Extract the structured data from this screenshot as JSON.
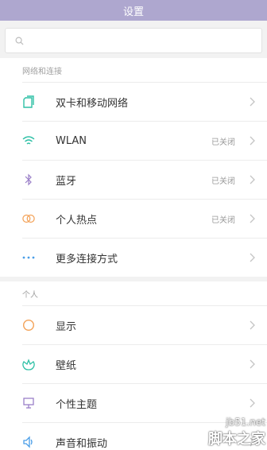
{
  "header": {
    "title": "设置"
  },
  "search": {
    "icon": "search-icon"
  },
  "sections": [
    {
      "title": "网络和连接",
      "items": [
        {
          "label": "双卡和移动网络",
          "status": "",
          "icon": "sim-card-icon",
          "icon_color": "#2fc0a6"
        },
        {
          "label": "WLAN",
          "status": "已关闭",
          "icon": "wifi-icon",
          "icon_color": "#2fc0a6"
        },
        {
          "label": "蓝牙",
          "status": "已关闭",
          "icon": "bluetooth-icon",
          "icon_color": "#9a7fc8"
        },
        {
          "label": "个人热点",
          "status": "已关闭",
          "icon": "hotspot-icon",
          "icon_color": "#f3a258"
        },
        {
          "label": "更多连接方式",
          "status": "",
          "icon": "more-dots-icon",
          "icon_color": "#4a9ee8"
        }
      ]
    },
    {
      "title": "个人",
      "items": [
        {
          "label": "显示",
          "status": "",
          "icon": "display-icon",
          "icon_color": "#f3a258"
        },
        {
          "label": "壁纸",
          "status": "",
          "icon": "wallpaper-icon",
          "icon_color": "#2fc0a6"
        },
        {
          "label": "个性主题",
          "status": "",
          "icon": "theme-icon",
          "icon_color": "#9a7fc8"
        },
        {
          "label": "声音和振动",
          "status": "",
          "icon": "sound-icon",
          "icon_color": "#4a9ee8"
        }
      ]
    }
  ],
  "watermark": {
    "url": "jb51.net",
    "name": "脚本之家"
  }
}
